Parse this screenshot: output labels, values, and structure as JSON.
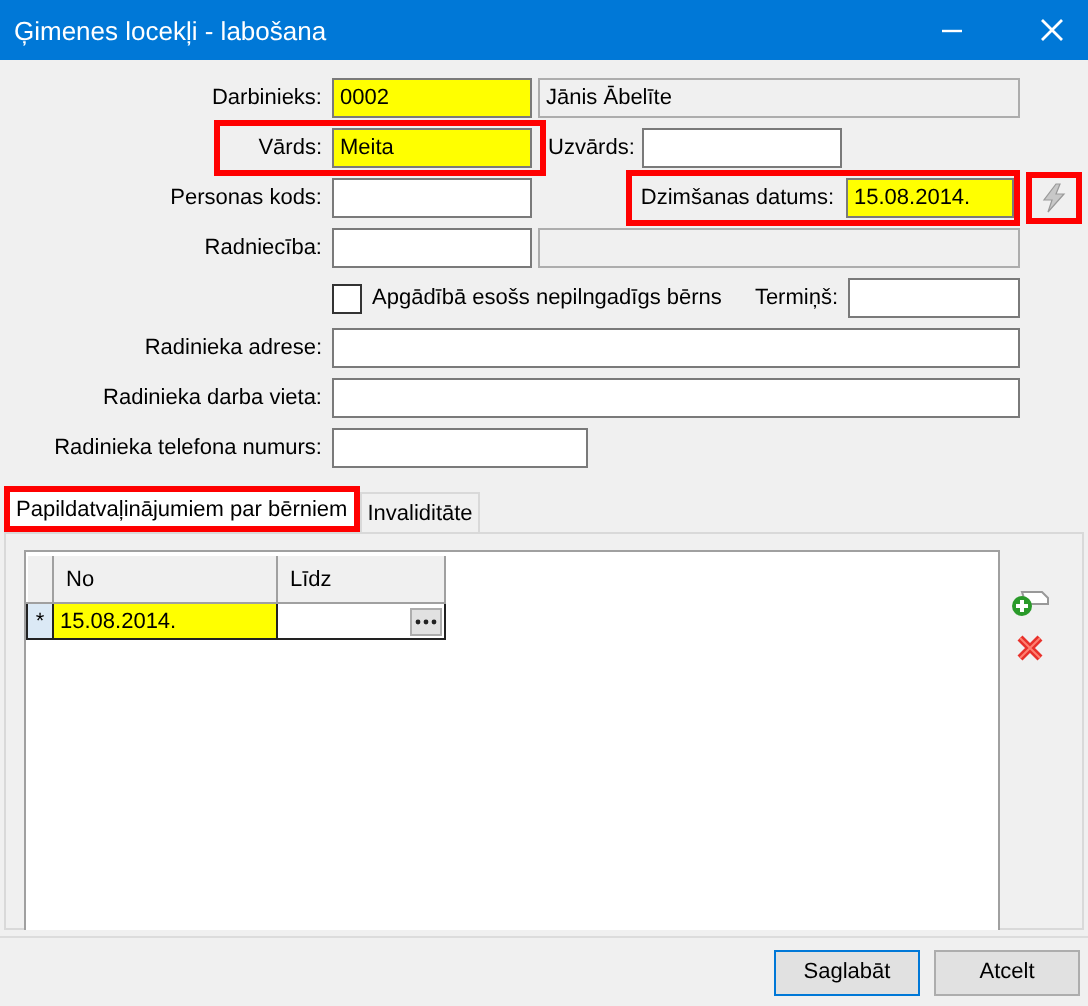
{
  "window": {
    "title": "Ģimenes locekļi - labošana"
  },
  "employee": {
    "label": "Darbinieks:",
    "code": {
      "value": "0002",
      "required": true
    },
    "name": {
      "value": "Jānis Ābelīte",
      "disabled": true
    }
  },
  "first_name": {
    "label": "Vārds:",
    "value": "Meita",
    "required": true,
    "highlighted": true
  },
  "last_name": {
    "label": "Uzvārds:",
    "required": false
  },
  "personal_code": {
    "label": "Personas kods:",
    "required": false
  },
  "birth_date": {
    "label": "Dzimšanas datums:",
    "value": "15.08.2014.",
    "required": true,
    "highlighted": true
  },
  "generate_button": {
    "disabled": true,
    "highlighted": true
  },
  "relation": {
    "label": "Radniecība:",
    "required": false,
    "description": {
      "disabled": true
    }
  },
  "dependent": {
    "label": "Apgādībā esošs nepilngadīgs bērns",
    "checked": false
  },
  "term": {
    "label": "Termiņš:",
    "required": false
  },
  "address": {
    "label": "Radinieka adrese:",
    "required": false
  },
  "workplace": {
    "label": "Radinieka darba vieta:",
    "required": false
  },
  "phone": {
    "label": "Radinieka telefona numurs:",
    "required": false
  },
  "tabs": [
    {
      "label": "Papildatvaļinājumiem par bērniem",
      "selected": true,
      "highlighted": true
    },
    {
      "label": "Invaliditāte",
      "selected": false,
      "highlighted": false
    }
  ],
  "grid": {
    "columns": [
      "No",
      "Līdz"
    ],
    "rows": [
      {
        "marker": "*",
        "cells": [
          {
            "value": "15.08.2014.",
            "required": true,
            "has_button": false
          },
          {
            "required": false,
            "has_button": true
          }
        ]
      }
    ]
  },
  "buttons": [
    {
      "label": "Saglabāt",
      "default": true
    },
    {
      "label": "Atcelt",
      "default": false
    }
  ]
}
